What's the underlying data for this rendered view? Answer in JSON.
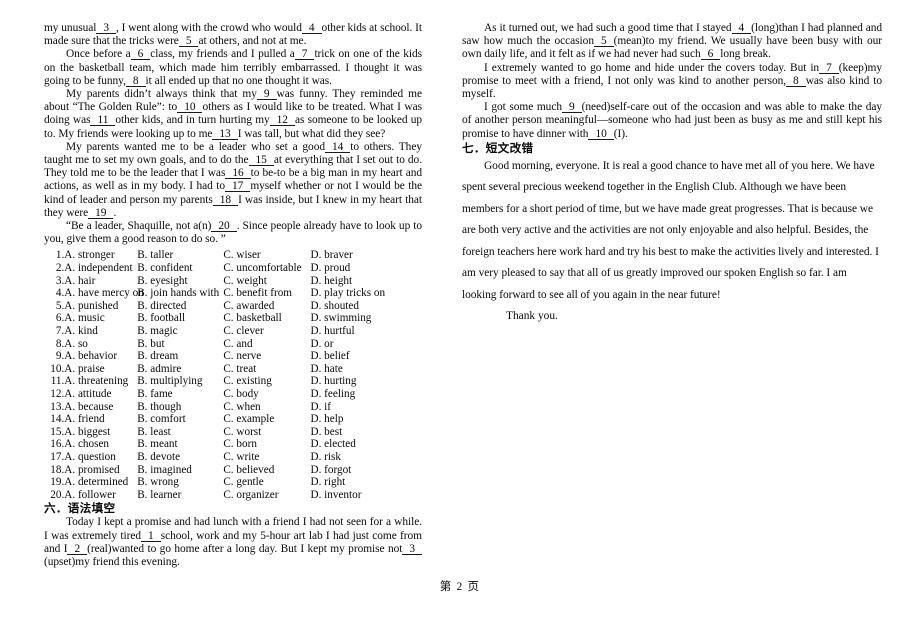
{
  "document": {
    "footer": "第 2 页"
  },
  "left_column": {
    "cloze_passage": {
      "paragraphs": [
        {
          "id": "p1",
          "indent": false,
          "runs": [
            {
              "t": "text",
              "v": "my unusual"
            },
            {
              "t": "blank",
              "v": "3"
            },
            {
              "t": "text",
              "v": ", I went along with the crowd who would"
            },
            {
              "t": "blank",
              "v": "4"
            },
            {
              "t": "text",
              "v": "other kids at school. It made sure that the tricks were"
            },
            {
              "t": "blank",
              "v": "5"
            },
            {
              "t": "text",
              "v": "at others, and not at me."
            }
          ]
        },
        {
          "id": "p2",
          "indent": true,
          "runs": [
            {
              "t": "text",
              "v": "Once before a"
            },
            {
              "t": "blank",
              "v": "6"
            },
            {
              "t": "text",
              "v": "class, my friends and I pulled a"
            },
            {
              "t": "blank",
              "v": "7"
            },
            {
              "t": "text",
              "v": "trick on one of the kids on the basketball team, which made him terribly embarrassed. I thought it was going to be funny,"
            },
            {
              "t": "blank",
              "v": "8"
            },
            {
              "t": "text",
              "v": "it all ended up that no one thought it was."
            }
          ]
        },
        {
          "id": "p3",
          "indent": true,
          "runs": [
            {
              "t": "text",
              "v": "My parents didn’t always think that my"
            },
            {
              "t": "blank",
              "v": "9"
            },
            {
              "t": "text",
              "v": "was funny. They reminded me about “The Golden Rule”: to"
            },
            {
              "t": "blank",
              "v": "10"
            },
            {
              "t": "text",
              "v": "others as I would like to be treated. What I was doing was"
            },
            {
              "t": "blank",
              "v": "11"
            },
            {
              "t": "text",
              "v": "other kids, and in turn hurting my"
            },
            {
              "t": "blank",
              "v": "12"
            },
            {
              "t": "text",
              "v": "as someone to be looked up to. My friends were looking up to me"
            },
            {
              "t": "blank",
              "v": "13"
            },
            {
              "t": "text",
              "v": "I was tall, but what did they see?"
            }
          ]
        },
        {
          "id": "p4",
          "indent": true,
          "runs": [
            {
              "t": "text",
              "v": "My parents wanted me to be a leader who set a good"
            },
            {
              "t": "blank",
              "v": "14"
            },
            {
              "t": "text",
              "v": "to others. They taught me to set my own goals, and to do the"
            },
            {
              "t": "blank",
              "v": "15"
            },
            {
              "t": "text",
              "v": "at everything that I set out to do. They told me to be the leader that I was"
            },
            {
              "t": "blank",
              "v": "16"
            },
            {
              "t": "text",
              "v": "to be-to be a big man in my heart and actions, as well as in my body. I had to"
            },
            {
              "t": "blank",
              "v": "17"
            },
            {
              "t": "text",
              "v": "myself whether or not I would be the kind of leader and person my parents"
            },
            {
              "t": "blank",
              "v": "18"
            },
            {
              "t": "text",
              "v": "I was inside, but I knew in my heart that they were"
            },
            {
              "t": "blank",
              "v": "19"
            },
            {
              "t": "text",
              "v": "."
            }
          ]
        },
        {
          "id": "p5",
          "indent": true,
          "runs": [
            {
              "t": "text",
              "v": "“Be a leader, Shaquille, not a(n)"
            },
            {
              "t": "blank",
              "v": "20"
            },
            {
              "t": "text",
              "v": ". Since people already have to look up to you, give them a good reason to do so. ”"
            }
          ]
        }
      ]
    },
    "options": {
      "rows": [
        {
          "num": "1.",
          "a": "A. stronger",
          "b": "B. taller",
          "c": "C. wiser",
          "d": "D. braver"
        },
        {
          "num": "2.",
          "a": "A. independent",
          "b": "B. confident",
          "c": "C. uncomfortable",
          "d": "D. proud"
        },
        {
          "num": "3.",
          "a": "A. hair",
          "b": "B. eyesight",
          "c": "C. weight",
          "d": "D. height"
        },
        {
          "num": "4.",
          "a": "A. have mercy on",
          "b": "B. join hands with",
          "c": "C. benefit from",
          "d": "D. play tricks on"
        },
        {
          "num": "5.",
          "a": "A. punished",
          "b": "B. directed",
          "c": "C. awarded",
          "d": "D. shouted"
        },
        {
          "num": "6.",
          "a": "A. music",
          "b": "B. football",
          "c": "C. basketball",
          "d": "D. swimming"
        },
        {
          "num": "7.",
          "a": "A. kind",
          "b": "B. magic",
          "c": "C. clever",
          "d": "D. hurtful"
        },
        {
          "num": "8.",
          "a": "A. so",
          "b": "B. but",
          "c": "C. and",
          "d": "D. or"
        },
        {
          "num": "9.",
          "a": "A. behavior",
          "b": "B. dream",
          "c": "C. nerve",
          "d": "D. belief"
        },
        {
          "num": "10.",
          "a": "A. praise",
          "b": "B. admire",
          "c": "C. treat",
          "d": "D. hate"
        },
        {
          "num": "11.",
          "a": "A. threatening",
          "b": "B. multiplying",
          "c": "C. existing",
          "d": "D. hurting"
        },
        {
          "num": "12.",
          "a": "A. attitude",
          "b": "B. fame",
          "c": "C. body",
          "d": "D. feeling"
        },
        {
          "num": "13.",
          "a": "A. because",
          "b": "B. though",
          "c": "C. when",
          "d": "D. if"
        },
        {
          "num": "14.",
          "a": "A. friend",
          "b": "B. comfort",
          "c": "C. example",
          "d": "D. help"
        },
        {
          "num": "15.",
          "a": "A. biggest",
          "b": "B. least",
          "c": "C. worst",
          "d": "D. best"
        },
        {
          "num": "16.",
          "a": "A. chosen",
          "b": "B. meant",
          "c": "C. born",
          "d": "D. elected"
        },
        {
          "num": "17.",
          "a": "A. question",
          "b": "B. devote",
          "c": "C. write",
          "d": "D. risk"
        },
        {
          "num": "18.",
          "a": "A. promised",
          "b": "B. imagined",
          "c": "C. believed",
          "d": "D. forgot"
        },
        {
          "num": "19.",
          "a": "A. determined",
          "b": "B. wrong",
          "c": "C. gentle",
          "d": "D. right"
        },
        {
          "num": "20.",
          "a": "A. follower",
          "b": "B. learner",
          "c": "C. organizer",
          "d": "D. inventor"
        }
      ]
    },
    "section_six": {
      "heading": "六．语法填空",
      "paragraph": {
        "indent": true,
        "runs": [
          {
            "t": "text",
            "v": "Today I kept a promise and had lunch with a friend I had not seen for a while.  I was extremely tired"
          },
          {
            "t": "blank",
            "v": "1"
          },
          {
            "t": "text",
            "v": "school, work and my 5-hour art lab I had just come from and I"
          },
          {
            "t": "blank",
            "v": "2"
          },
          {
            "t": "text",
            "v": "(real)wanted to go home after a long day.  But I kept my promise not"
          },
          {
            "t": "blank",
            "v": "3"
          },
          {
            "t": "text",
            "v": "(upset)my friend this evening."
          }
        ]
      }
    }
  },
  "right_column": {
    "grammar_continued": {
      "paragraphs": [
        {
          "id": "r1",
          "indent": true,
          "runs": [
            {
              "t": "text",
              "v": "As it turned out, we had such a good time that I stayed"
            },
            {
              "t": "blank",
              "v": "4"
            },
            {
              "t": "text",
              "v": "(long)than I had planned and saw how much the occasion"
            },
            {
              "t": "blank",
              "v": "5"
            },
            {
              "t": "text",
              "v": "(mean)to my friend.  We usually have been busy with our own daily life, and it felt as if we had never had such"
            },
            {
              "t": "blank",
              "v": "6"
            },
            {
              "t": "text",
              "v": "long break."
            }
          ]
        },
        {
          "id": "r2",
          "indent": true,
          "runs": [
            {
              "t": "text",
              "v": "I extremely wanted to go home and hide under the covers today. But in"
            },
            {
              "t": "blank",
              "v": "7"
            },
            {
              "t": "text",
              "v": "(keep)my promise to meet with a friend, I not only was kind to another person,"
            },
            {
              "t": "blank",
              "v": "8"
            },
            {
              "t": "text",
              "v": "was also kind to myself."
            }
          ]
        },
        {
          "id": "r3",
          "indent": true,
          "runs": [
            {
              "t": "text",
              "v": "I got some much"
            },
            {
              "t": "blank",
              "v": "9"
            },
            {
              "t": "text",
              "v": "(need)self-care out of the occasion and was able to make the day of another person meaningful—someone who had just been as busy as me and still kept his promise to have dinner with"
            },
            {
              "t": "blank",
              "v": "10"
            },
            {
              "t": "text",
              "v": "(I)."
            }
          ]
        }
      ]
    },
    "section_seven": {
      "heading": "七．短文改错",
      "paragraphs": [
        {
          "id": "s1",
          "indent": true,
          "text": "Good morning, everyone.  It is real a good chance to have met all of you here.  We have spent several precious weekend together in the English Club.  Although we have been members for a short period of time, but we have made great progresses.  That is because we are both very active and the activities are not only enjoyable and also helpful.  Besides, the foreign teachers here work hard and try his best to make the activities lively and interested.  I am very pleased to say that all of us greatly improved our spoken English so far.  I am looking forward to see all of you again in the near future!"
        }
      ],
      "closing": "Thank you."
    }
  }
}
